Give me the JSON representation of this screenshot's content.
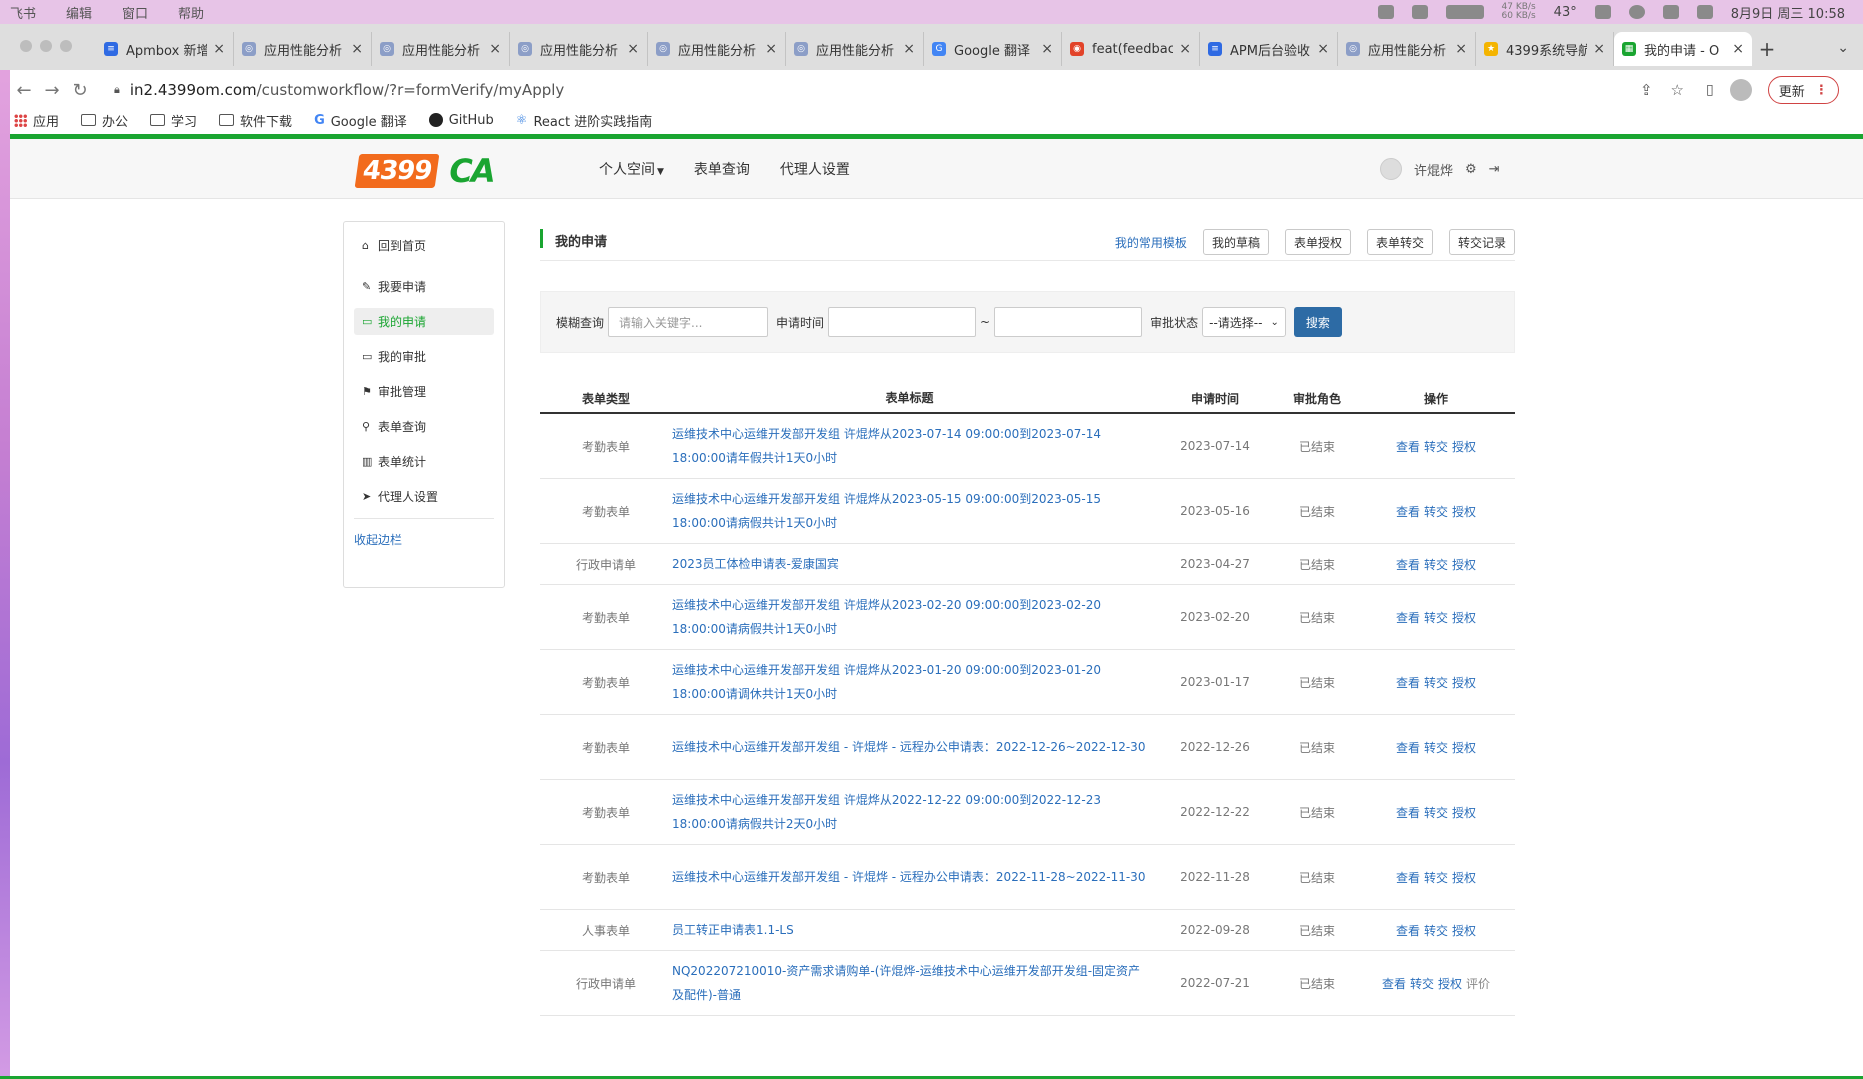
{
  "menubar": {
    "items": [
      "飞书",
      "编辑",
      "窗口",
      "帮助"
    ],
    "net_up": "47 KB/s",
    "net_down": "60 KB/s",
    "temp": "43°",
    "datetime": "8月9日 周三  10:58"
  },
  "tabs": [
    {
      "label": "Apmbox 新增",
      "fav": "doc",
      "color": "#2f6ae3"
    },
    {
      "label": "应用性能分析",
      "fav": "globe",
      "color": "#8c9ec7"
    },
    {
      "label": "应用性能分析",
      "fav": "globe",
      "color": "#8c9ec7"
    },
    {
      "label": "应用性能分析",
      "fav": "globe",
      "color": "#8c9ec7"
    },
    {
      "label": "应用性能分析",
      "fav": "globe",
      "color": "#8c9ec7"
    },
    {
      "label": "应用性能分析",
      "fav": "globe",
      "color": "#8c9ec7"
    },
    {
      "label": "Google 翻译",
      "fav": "translate",
      "color": "#4285f4"
    },
    {
      "label": "feat(feedbac",
      "fav": "git",
      "color": "#e24329"
    },
    {
      "label": "APM后台验收",
      "fav": "doc",
      "color": "#2f6ae3"
    },
    {
      "label": "应用性能分析",
      "fav": "globe",
      "color": "#8c9ec7"
    },
    {
      "label": "4399系统导航",
      "fav": "star",
      "color": "#f4b400"
    },
    {
      "label": "我的申请 - O",
      "fav": "sheet",
      "color": "#1aa531",
      "active": true
    }
  ],
  "address": {
    "host": "in2.4399om.com",
    "path": "/customworkflow/?r=formVerify/myApply",
    "update_label": "更新"
  },
  "bookmarks": [
    {
      "label": "应用",
      "icon": "apps-grid-icon"
    },
    {
      "label": "办公",
      "icon": "folder-icon"
    },
    {
      "label": "学习",
      "icon": "folder-icon"
    },
    {
      "label": "软件下载",
      "icon": "folder-icon"
    },
    {
      "label": "Google 翻译",
      "icon": "translate-icon"
    },
    {
      "label": "GitHub",
      "icon": "github-icon"
    },
    {
      "label": "React 进阶实践指南",
      "icon": "react-icon"
    }
  ],
  "app": {
    "logo_text": "4399",
    "logo_ca": "CA",
    "nav": [
      "个人空间",
      "表单查询",
      "代理人设置"
    ],
    "username": "许焜烨"
  },
  "sidebar": {
    "home": "回到首页",
    "items": [
      {
        "label": "我要申请",
        "icon": "✎"
      },
      {
        "label": "我的申请",
        "icon": "▭",
        "active": true
      },
      {
        "label": "我的审批",
        "icon": "▭"
      },
      {
        "label": "审批管理",
        "icon": "⚑"
      },
      {
        "label": "表单查询",
        "icon": "⚲"
      },
      {
        "label": "表单统计",
        "icon": "▥"
      },
      {
        "label": "代理人设置",
        "icon": "➤"
      }
    ],
    "collapse": "收起边栏"
  },
  "main": {
    "title": "我的申请",
    "templates_link": "我的常用模板",
    "buttons": [
      "我的草稿",
      "表单授权",
      "表单转交",
      "转交记录"
    ]
  },
  "search": {
    "keyword_label": "模糊查询",
    "keyword_placeholder": "请输入关键字...",
    "time_label": "申请时间",
    "tilde": "~",
    "status_label": "审批状态",
    "status_selected": "--请选择--",
    "submit": "搜索"
  },
  "table": {
    "headers": [
      "表单类型",
      "表单标题",
      "申请时间",
      "审批角色",
      "操作"
    ],
    "rows": [
      {
        "type": "考勤表单",
        "title": "运维技术中心运维开发部开发组 许焜烨从2023-07-14 09:00:00到2023-07-14 18:00:00请年假共计1天0小时",
        "date": "2023-07-14",
        "role": "已结束",
        "ops": [
          "查看",
          "转交",
          "授权"
        ]
      },
      {
        "type": "考勤表单",
        "title": "运维技术中心运维开发部开发组 许焜烨从2023-05-15 09:00:00到2023-05-15 18:00:00请病假共计1天0小时",
        "date": "2023-05-16",
        "role": "已结束",
        "ops": [
          "查看",
          "转交",
          "授权"
        ]
      },
      {
        "type": "行政申请单",
        "title": "2023员工体检申请表-爱康国宾",
        "date": "2023-04-27",
        "role": "已结束",
        "ops": [
          "查看",
          "转交",
          "授权"
        ]
      },
      {
        "type": "考勤表单",
        "title": "运维技术中心运维开发部开发组 许焜烨从2023-02-20 09:00:00到2023-02-20 18:00:00请病假共计1天0小时",
        "date": "2023-02-20",
        "role": "已结束",
        "ops": [
          "查看",
          "转交",
          "授权"
        ]
      },
      {
        "type": "考勤表单",
        "title": "运维技术中心运维开发部开发组 许焜烨从2023-01-20 09:00:00到2023-01-20 18:00:00请调休共计1天0小时",
        "date": "2023-01-17",
        "role": "已结束",
        "ops": [
          "查看",
          "转交",
          "授权"
        ]
      },
      {
        "type": "考勤表单",
        "title": "运维技术中心运维开发部开发组 - 许焜烨 - 远程办公申请表：2022-12-26~2022-12-30",
        "date": "2022-12-26",
        "role": "已结束",
        "ops": [
          "查看",
          "转交",
          "授权"
        ]
      },
      {
        "type": "考勤表单",
        "title": "运维技术中心运维开发部开发组 许焜烨从2022-12-22 09:00:00到2022-12-23 18:00:00请病假共计2天0小时",
        "date": "2022-12-22",
        "role": "已结束",
        "ops": [
          "查看",
          "转交",
          "授权"
        ]
      },
      {
        "type": "考勤表单",
        "title": "运维技术中心运维开发部开发组 - 许焜烨 - 远程办公申请表：2022-11-28~2022-11-30",
        "date": "2022-11-28",
        "role": "已结束",
        "ops": [
          "查看",
          "转交",
          "授权"
        ]
      },
      {
        "type": "人事表单",
        "title": "员工转正申请表1.1-LS",
        "date": "2022-09-28",
        "role": "已结束",
        "ops": [
          "查看",
          "转交",
          "授权"
        ]
      },
      {
        "type": "行政申请单",
        "title": "NQ202207210010-资产需求请购单-(许焜烨-运维技术中心运维开发部开发组-固定资产及配件)-普通",
        "date": "2022-07-21",
        "role": "已结束",
        "ops": [
          "查看",
          "转交",
          "授权",
          "评价"
        ]
      }
    ]
  },
  "colors": {
    "brand_green": "#1aa531",
    "link_blue": "#2a6ebb",
    "search_button": "#2d6ba5",
    "logo_orange": "#f26b1d"
  }
}
